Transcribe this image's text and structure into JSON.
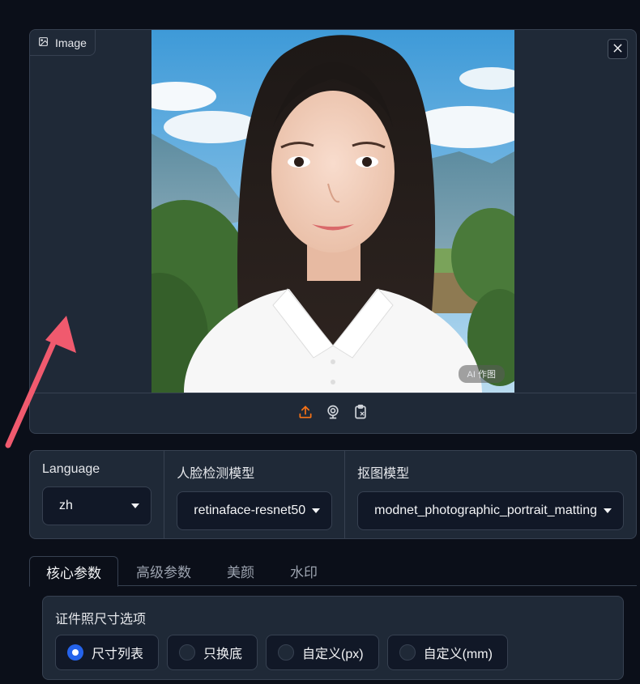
{
  "image_component": {
    "label": "Image",
    "ai_badge": "AI 作图"
  },
  "dropdowns": [
    {
      "label": "Language",
      "value": "zh"
    },
    {
      "label": "人脸检测模型",
      "value": "retinaface-resnet50"
    },
    {
      "label": "抠图模型",
      "value": "modnet_photographic_portrait_matting"
    }
  ],
  "tabs": [
    "核心参数",
    "高级参数",
    "美颜",
    "水印"
  ],
  "active_tab": "核心参数",
  "size_options": {
    "title": "证件照尺寸选项",
    "options": [
      "尺寸列表",
      "只换底",
      "自定义(px)",
      "自定义(mm)"
    ],
    "selected": "尺寸列表"
  },
  "colors": {
    "accent_blue": "#2563eb",
    "upload_orange": "#f97316",
    "arrow_red": "#f05a6e"
  },
  "icons": [
    "image-icon",
    "close-icon",
    "upload-icon",
    "webcam-icon",
    "clipboard-icon"
  ]
}
